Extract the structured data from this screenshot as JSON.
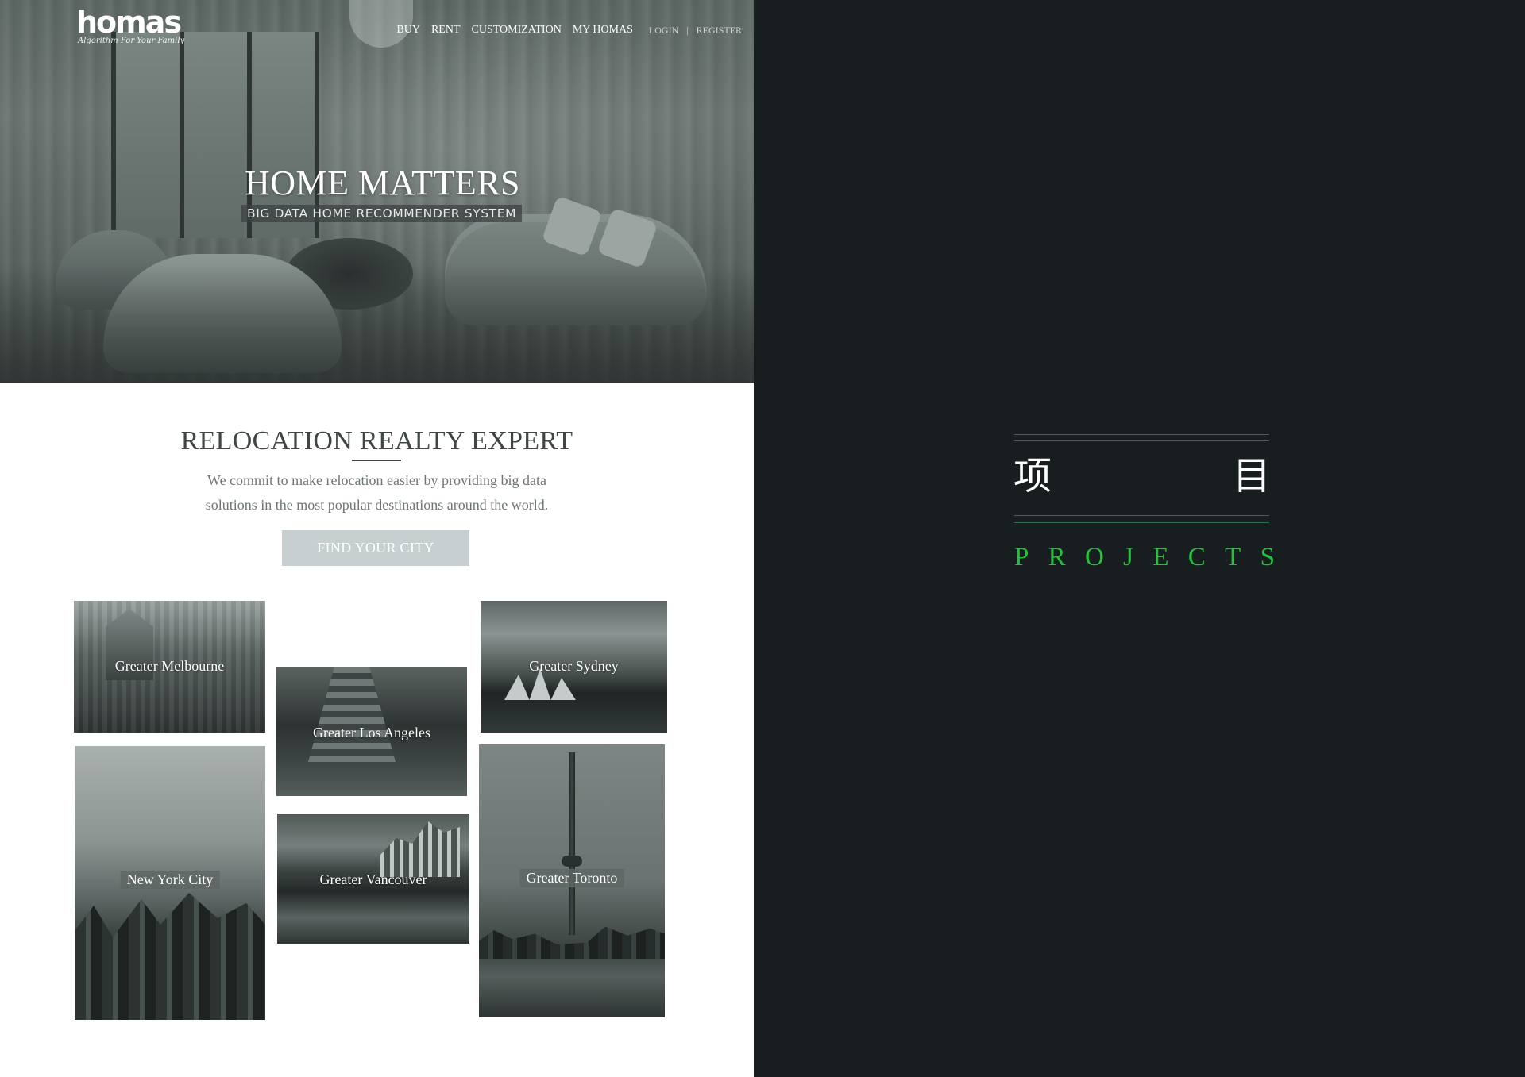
{
  "site": {
    "logo": {
      "wordmark": "homas",
      "tagline": "Algorithm For Your Family"
    },
    "nav": {
      "items": [
        "BUY",
        "RENT",
        "CUSTOMIZATION",
        "MY HOMAS"
      ],
      "login": "LOGIN",
      "separator": "|",
      "register": "REGISTER"
    },
    "hero": {
      "title": "HOME MATTERS",
      "subtitle": "BIG DATA HOME RECOMMENDER SYSTEM"
    },
    "intro": {
      "title": "RELOCATION REALTY EXPERT",
      "line1": "We commit to make relocation easier by providing big data",
      "line2": "solutions in the most popular destinations around the world.",
      "button": "FIND YOUR CITY"
    },
    "cities": {
      "melbourne": "Greater Melbourne",
      "los_angeles": "Greater Los Angeles",
      "sydney": "Greater Sydney",
      "new_york": "New York City",
      "vancouver": "Greater Vancouver",
      "toronto": "Greater Toronto"
    }
  },
  "section": {
    "cn_left": "项",
    "cn_right": "目",
    "en_letters": [
      "P",
      "R",
      "O",
      "J",
      "E",
      "C",
      "T",
      "S"
    ]
  },
  "colors": {
    "panel_bg": "#181e1f",
    "accent_green": "#22c23a",
    "rule_green": "#2c6e4f",
    "button_bg": "#c7cfd1"
  }
}
